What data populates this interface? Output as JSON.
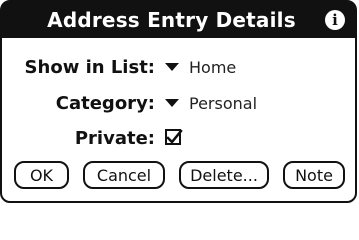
{
  "window": {
    "title": "Address Entry Details"
  },
  "fields": {
    "show_in_list": {
      "label": "Show in List:",
      "value": "Home"
    },
    "category": {
      "label": "Category:",
      "value": "Personal"
    },
    "private": {
      "label": "Private:",
      "checked": true
    }
  },
  "buttons": {
    "ok": "OK",
    "cancel": "Cancel",
    "delete": "Delete...",
    "note": "Note"
  },
  "icons": {
    "info": "info-icon",
    "dropdown": "chevron-down-icon",
    "checkbox": "checkbox-icon"
  }
}
